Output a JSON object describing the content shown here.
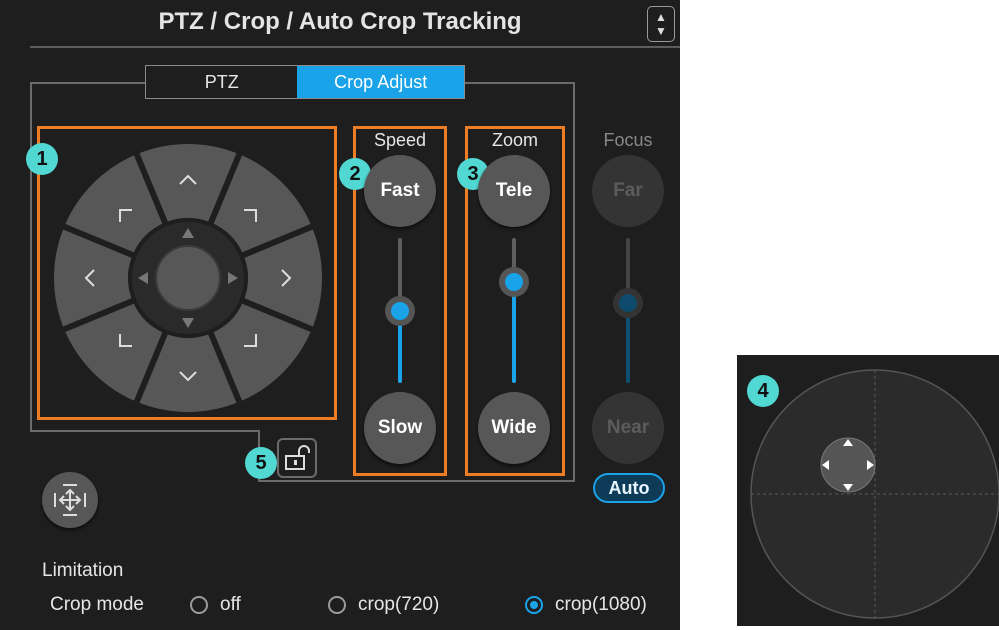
{
  "panel": {
    "title": "PTZ / Crop / Auto Crop Tracking",
    "tabs": [
      {
        "label": "PTZ",
        "active": false
      },
      {
        "label": "Crop Adjust",
        "active": true
      }
    ]
  },
  "badges": {
    "dpad": "1",
    "speed": "2",
    "zoom": "3",
    "joystick": "4",
    "lock": "5"
  },
  "speed": {
    "label": "Speed",
    "top_button": "Fast",
    "bottom_button": "Slow",
    "level": 0.5
  },
  "zoom": {
    "label": "Zoom",
    "top_button": "Tele",
    "bottom_button": "Wide",
    "level": 0.7
  },
  "focus": {
    "label": "Focus",
    "top_button": "Far",
    "bottom_button": "Near",
    "level": 0.55,
    "auto_label": "Auto"
  },
  "limitation": {
    "label": "Limitation"
  },
  "crop_mode": {
    "label": "Crop mode",
    "options": [
      {
        "label": "off",
        "selected": false
      },
      {
        "label": "crop(720)",
        "selected": false
      },
      {
        "label": "crop(1080)",
        "selected": true
      }
    ]
  },
  "colors": {
    "accent": "#1aa3e8",
    "highlight_box": "#ee7d23",
    "badge": "#52d8d2",
    "panel_bg": "#1e1e1e"
  },
  "icons": {
    "dpad_up": "chevron-up-icon",
    "dpad_down": "chevron-down-icon",
    "dpad_left": "chevron-left-icon",
    "dpad_right": "chevron-right-icon",
    "dpad_corners": "corner-bracket-icon",
    "lock": "unlock-icon",
    "limitation": "move-arrows-icon",
    "scroll": "up-down-arrows-icon"
  }
}
